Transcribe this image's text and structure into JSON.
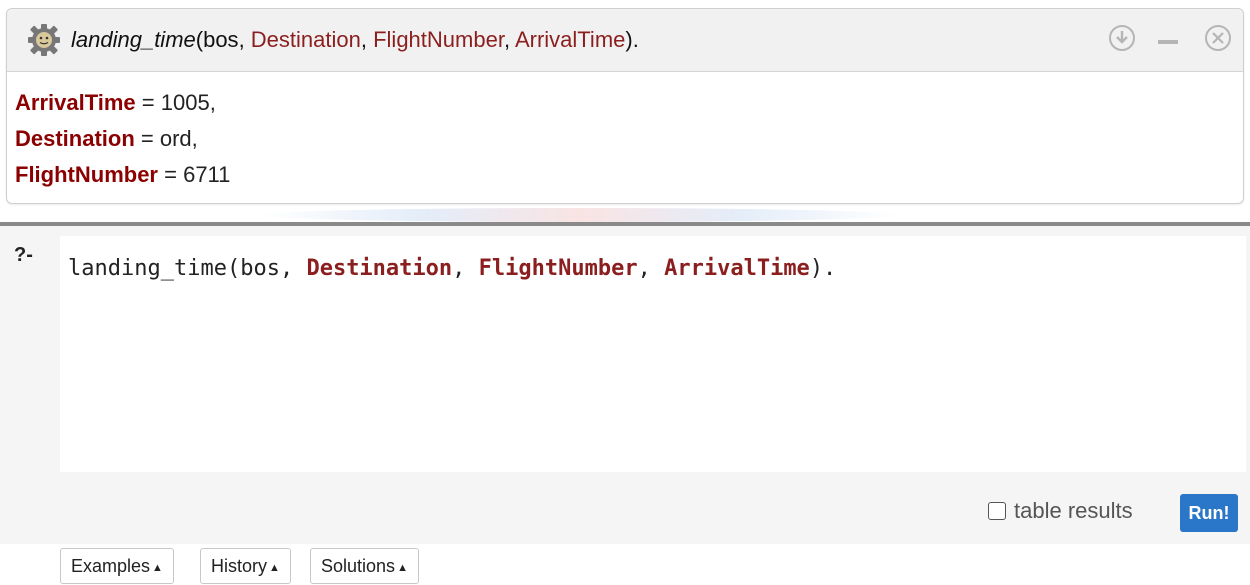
{
  "result": {
    "query_predicate": "landing_time",
    "query_args": [
      {
        "text": "bos",
        "is_var": false
      },
      {
        "text": "Destination",
        "is_var": true
      },
      {
        "text": "FlightNumber",
        "is_var": true
      },
      {
        "text": "ArrivalTime",
        "is_var": true
      }
    ],
    "icons": [
      "download-icon",
      "minimize-icon",
      "close-icon"
    ],
    "answers": [
      {
        "name": "ArrivalTime",
        "value": "1005",
        "sep": ","
      },
      {
        "name": "Destination",
        "value": "ord",
        "sep": ","
      },
      {
        "name": "FlightNumber",
        "value": "6711",
        "sep": ""
      }
    ]
  },
  "editor": {
    "prompt": "?-",
    "code_pred": "landing_time",
    "code_args": [
      {
        "text": "bos",
        "is_var": false
      },
      {
        "text": "Destination",
        "is_var": true
      },
      {
        "text": "FlightNumber",
        "is_var": true
      },
      {
        "text": "ArrivalTime",
        "is_var": true
      }
    ]
  },
  "toolbar": {
    "examples_label": "Examples",
    "history_label": "History",
    "solutions_label": "Solutions",
    "table_results_label": "table results",
    "table_results_checked": false,
    "run_label": "Run!"
  },
  "colors": {
    "variable": "#8b1f1f",
    "answer_name": "#8b0000",
    "run_button": "#2a77c9"
  }
}
